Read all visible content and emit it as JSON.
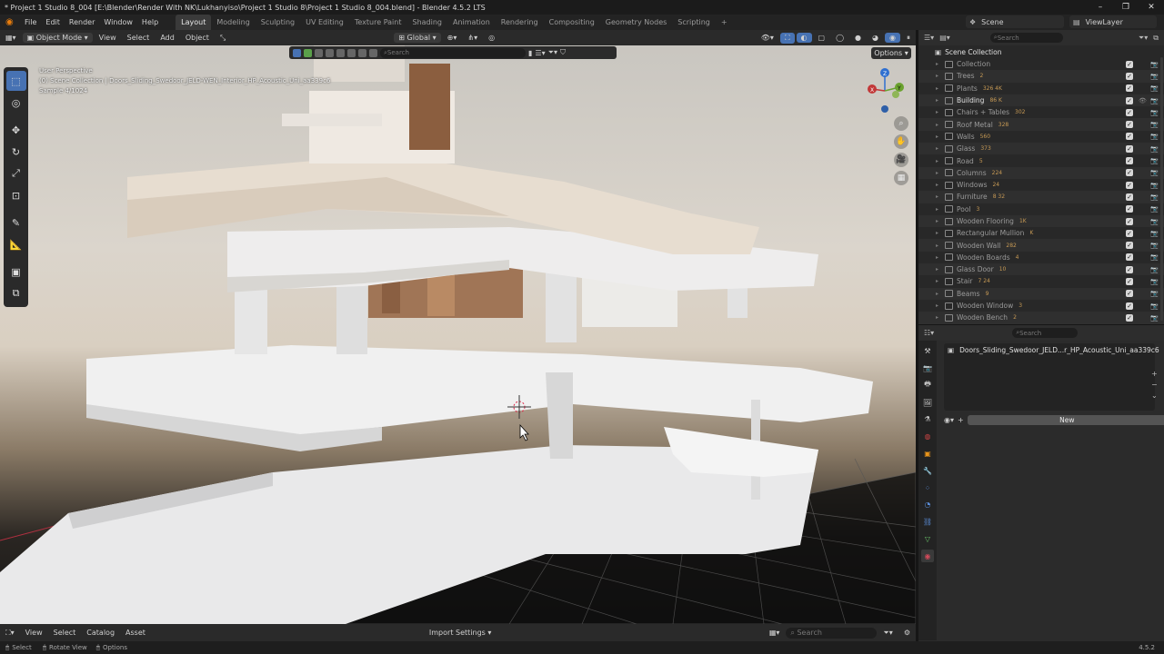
{
  "window": {
    "title": "* Project 1 Studio 8_004 [E:\\Blender\\Render With NK\\Lukhanyiso\\Project 1 Studio 8\\Project 1 Studio 8_004.blend] - Blender 4.5.2 LTS",
    "minimize": "–",
    "maximize": "❐",
    "close": "✕"
  },
  "menu": {
    "items": [
      "File",
      "Edit",
      "Render",
      "Window",
      "Help"
    ],
    "workspaces": [
      "Layout",
      "Modeling",
      "Sculpting",
      "UV Editing",
      "Texture Paint",
      "Shading",
      "Animation",
      "Rendering",
      "Compositing",
      "Geometry Nodes",
      "Scripting"
    ],
    "add_workspace": "+",
    "scene": "Scene",
    "view_layer": "ViewLayer"
  },
  "viewport_header": {
    "mode": "Object Mode",
    "menus": [
      "View",
      "Select",
      "Add",
      "Object"
    ],
    "orientation": "Global",
    "options": "Options",
    "search_placeholder": "Search"
  },
  "viewport_info": {
    "line1": "User Perspective",
    "line2": "(0) Scene Collection | Doors_Sliding_Swedoor_JELD-WEN_Interior_HP_Acoustic_Uni_aa339c6",
    "line3": "Sample 4/1024"
  },
  "gizmo": {
    "x": "X",
    "y": "Y",
    "z": "Z"
  },
  "outliner": {
    "search_placeholder": "Search",
    "root": "Scene Collection",
    "rows": [
      {
        "label": "Collection",
        "badge": ""
      },
      {
        "label": "Trees",
        "badge": "2"
      },
      {
        "label": "Plants",
        "badge": "326  4K"
      },
      {
        "label": "Building",
        "badge": "86  K"
      },
      {
        "label": "Chairs + Tables",
        "badge": "302"
      },
      {
        "label": "Roof Metal",
        "badge": "328"
      },
      {
        "label": "Walls",
        "badge": "560"
      },
      {
        "label": "Glass",
        "badge": "373"
      },
      {
        "label": "Road",
        "badge": "5"
      },
      {
        "label": "Columns",
        "badge": "224"
      },
      {
        "label": "Windows",
        "badge": "24"
      },
      {
        "label": "Furniture",
        "badge": "8  32"
      },
      {
        "label": "Pool",
        "badge": "3"
      },
      {
        "label": "Wooden Flooring",
        "badge": "1K"
      },
      {
        "label": "Rectangular Mullion",
        "badge": "K"
      },
      {
        "label": "Wooden Wall",
        "badge": "282"
      },
      {
        "label": "Wooden Boards",
        "badge": "4"
      },
      {
        "label": "Glass Door",
        "badge": "10"
      },
      {
        "label": "Stair",
        "badge": "7  24"
      },
      {
        "label": "Beams",
        "badge": "9"
      },
      {
        "label": "Wooden Window",
        "badge": "3"
      },
      {
        "label": "Wooden Bench",
        "badge": "2"
      }
    ]
  },
  "properties": {
    "search_placeholder": "Search",
    "material_slot": "Doors_Sliding_Swedoor_JELD...r_HP_Acoustic_Uni_aa339c6",
    "new_button": "New"
  },
  "asset_header": {
    "menus": [
      "View",
      "Select",
      "Catalog",
      "Asset"
    ],
    "import_settings": "Import Settings",
    "search_placeholder": "Search"
  },
  "statusbar": {
    "select": "Select",
    "rotate": "Rotate View",
    "options": "Options",
    "version": "4.5.2"
  },
  "colors": {
    "accent": "#4772b3",
    "orange": "#e87d0d",
    "badge": "#c79a55"
  }
}
